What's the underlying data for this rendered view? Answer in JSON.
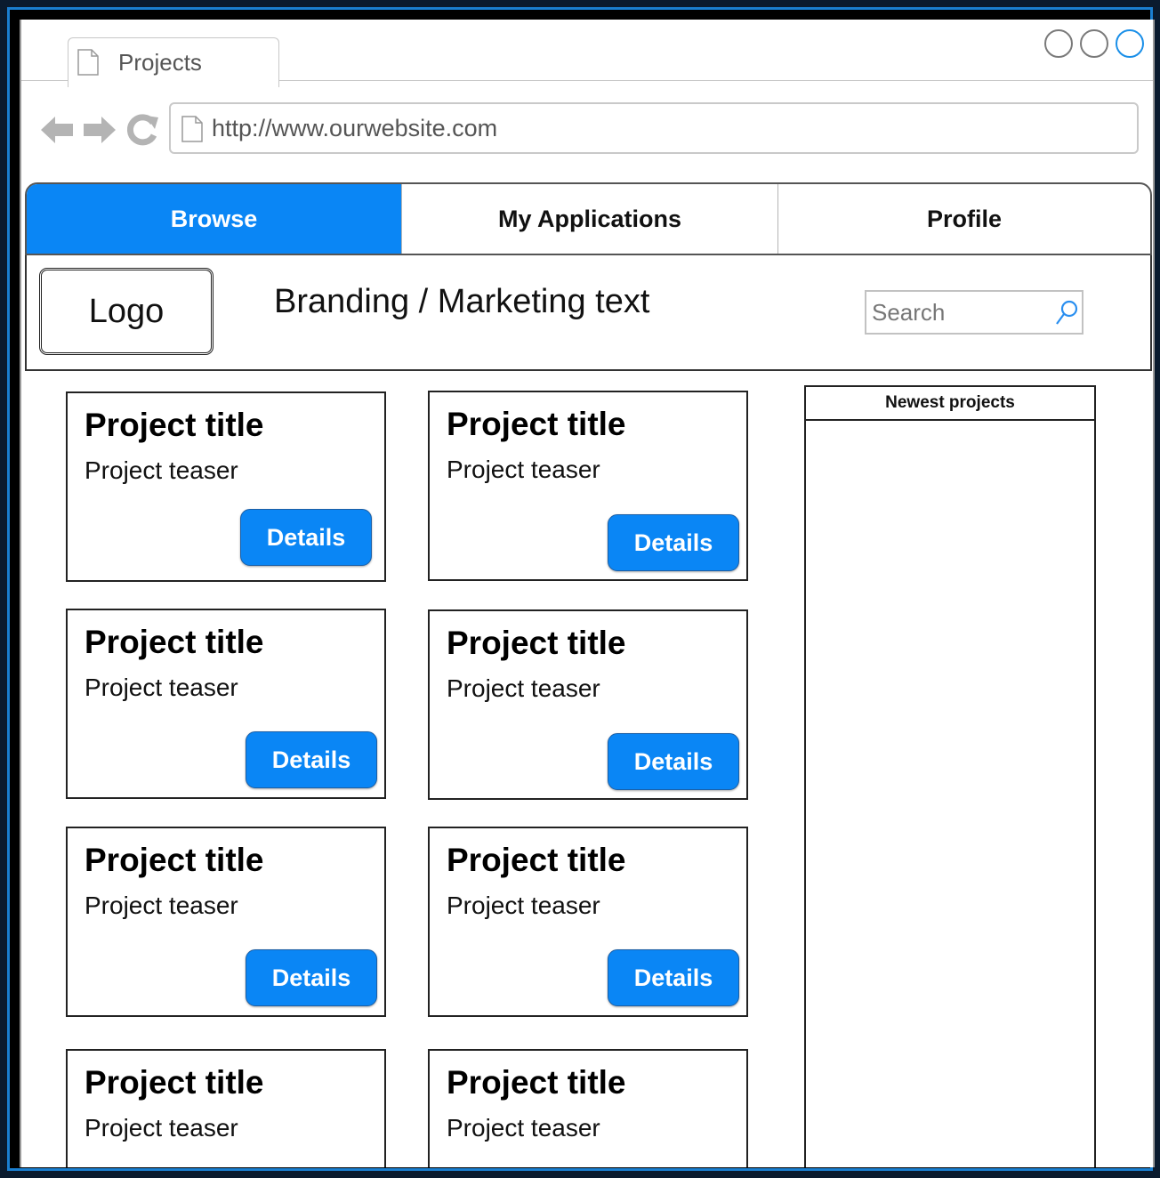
{
  "browser": {
    "tab_title": "Projects",
    "url": "http://www.ourwebsite.com",
    "window_controls": [
      "minimize-circle",
      "zoom-circle",
      "close-circle"
    ],
    "icons": [
      "page-icon",
      "back-arrow-icon",
      "forward-arrow-icon",
      "reload-icon"
    ]
  },
  "nav": {
    "tabs": [
      {
        "label": "Browse",
        "active": true
      },
      {
        "label": "My Applications",
        "active": false
      },
      {
        "label": "Profile",
        "active": false
      }
    ],
    "accent_color": "#0a86f5"
  },
  "header": {
    "logo": "Logo",
    "branding": "Branding / Marketing text",
    "search_placeholder": "Search"
  },
  "projects": [
    {
      "title": "Project title",
      "teaser": "Project teaser",
      "button": "Details"
    },
    {
      "title": "Project title",
      "teaser": "Project teaser",
      "button": "Details"
    },
    {
      "title": "Project title",
      "teaser": "Project teaser",
      "button": "Details"
    },
    {
      "title": "Project title",
      "teaser": "Project teaser",
      "button": "Details"
    },
    {
      "title": "Project title",
      "teaser": "Project teaser",
      "button": "Details"
    },
    {
      "title": "Project title",
      "teaser": "Project teaser",
      "button": "Details"
    },
    {
      "title": "Project title",
      "teaser": "Project teaser"
    },
    {
      "title": "Project title",
      "teaser": "Project teaser"
    }
  ],
  "sidebar": {
    "title": "Newest projects"
  }
}
